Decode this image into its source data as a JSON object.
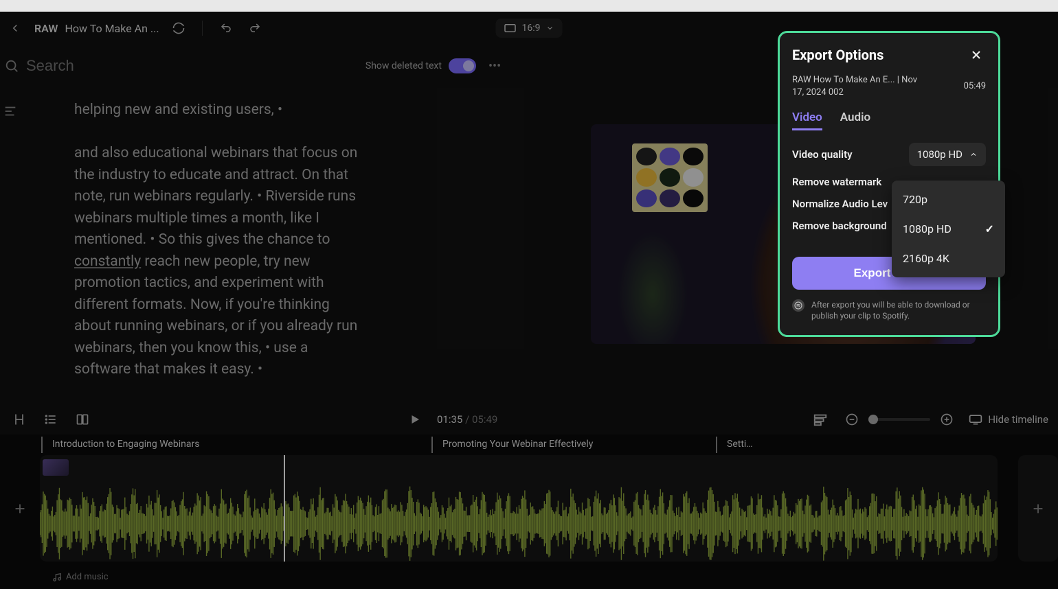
{
  "header": {
    "raw_badge": "RAW",
    "title": "How To Make An ...",
    "aspect_ratio": "16:9"
  },
  "search": {
    "placeholder": "Search",
    "toggle_label": "Show deleted text"
  },
  "transcript": {
    "line_top": "helping new and existing users, •",
    "para1_a": "and also educational webinars that focus on the industry to educate and attract. On that note, run webinars regularly. • Riverside runs webinars multiple times a month, like I mentioned. • So this gives the chance to ",
    "underlined": "constantly",
    "para1_b": " reach new people, try new promotion tactics, and experiment with different formats. Now, if you're thinking about running webinars, or if you already run webinars, then you know this, • use a software that makes it easy. •"
  },
  "transport": {
    "current": "01:35",
    "total": "05:49",
    "hide_timeline": "Hide timeline"
  },
  "chapters": {
    "c1": "Introduction to Engaging Webinars",
    "c2": "Promoting Your Webinar Effectively",
    "c3": "Setti…"
  },
  "add_music": "Add music",
  "export": {
    "title": "Export Options",
    "file_name": "RAW How To Make An E... | Nov 17, 2024 002",
    "duration": "05:49",
    "tab_video": "Video",
    "tab_audio": "Audio",
    "vq_label": "Video quality",
    "vq_value": "1080p HD",
    "opt_720": "720p",
    "opt_1080": "1080p HD",
    "opt_2160": "2160p 4K",
    "row_watermark": "Remove watermark",
    "row_normalize": "Normalize Audio Lev",
    "row_bg": "Remove background",
    "button": "Export video",
    "footer": "After export you will be able to download or publish your clip to Spotify."
  }
}
